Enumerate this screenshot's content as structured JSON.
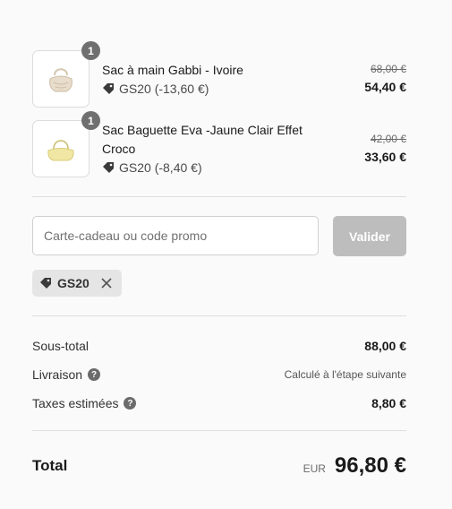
{
  "items": [
    {
      "quantity": "1",
      "name": "Sac à main Gabbi - Ivoire",
      "discount": "GS20 (-13,60 €)",
      "old_price": "68,00 €",
      "new_price": "54,40 €",
      "image_color": "#e8dccb"
    },
    {
      "quantity": "1",
      "name": "Sac Baguette Eva -Jaune Clair Effet Croco",
      "discount": "GS20 (-8,40 €)",
      "old_price": "42,00 €",
      "new_price": "33,60 €",
      "image_color": "#f1e7a4"
    }
  ],
  "promo": {
    "placeholder": "Carte-cadeau ou code promo",
    "button_label": "Valider",
    "applied_code": "GS20"
  },
  "summary": {
    "subtotal_label": "Sous-total",
    "subtotal_value": "88,00 €",
    "shipping_label": "Livraison",
    "shipping_value": "Calculé à l'étape suivante",
    "taxes_label": "Taxes estimées",
    "taxes_value": "8,80 €",
    "total_label": "Total",
    "currency": "EUR",
    "total_value": "96,80 €"
  },
  "colors": {
    "button_disabled": "#bdbdbd",
    "badge": "#6f6f6f",
    "chip": "#e5e5e5"
  }
}
